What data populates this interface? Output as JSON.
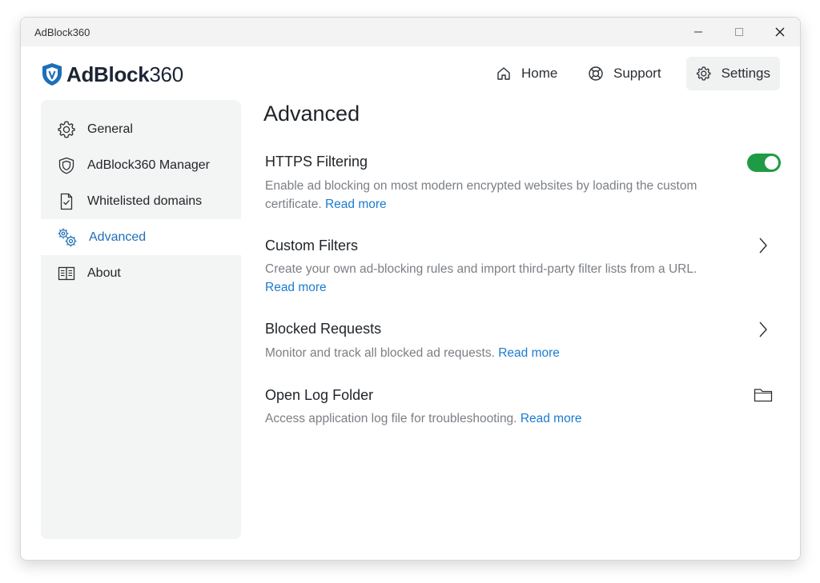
{
  "window": {
    "title": "AdBlock360"
  },
  "brand": {
    "name_bold": "AdBlock",
    "name_light": "360",
    "accent": "#1e6fb8"
  },
  "top_nav": {
    "home": "Home",
    "support": "Support",
    "settings": "Settings",
    "active": "settings"
  },
  "sidebar": {
    "items": [
      {
        "label": "General",
        "icon": "gear-icon"
      },
      {
        "label": "AdBlock360 Manager",
        "icon": "shield-icon"
      },
      {
        "label": "Whitelisted domains",
        "icon": "checked-document-icon"
      },
      {
        "label": "Advanced",
        "icon": "gears-icon",
        "active": true
      },
      {
        "label": "About",
        "icon": "book-icon"
      }
    ]
  },
  "main": {
    "title": "Advanced",
    "settings": [
      {
        "title": "HTTPS Filtering",
        "desc_line1": "Enable ad blocking on most modern encrypted websites by loading the custom",
        "desc_line2": "certificate.",
        "link": "Read more",
        "control": "toggle",
        "enabled": true,
        "toggle_color": "#1f9b45"
      },
      {
        "title": "Custom Filters",
        "desc_line1": "Create your own ad-blocking rules and import third-party filter lists from a URL.",
        "link": "Read more",
        "control": "chevron-right-icon"
      },
      {
        "title": "Blocked Requests",
        "desc_line1": "Monitor and track all blocked ad requests.",
        "link": "Read more",
        "control": "chevron-right-icon"
      },
      {
        "title": "Open Log Folder",
        "desc_line1": "Access application log file for troubleshooting.",
        "link": "Read more",
        "control": "folder-icon"
      }
    ]
  }
}
